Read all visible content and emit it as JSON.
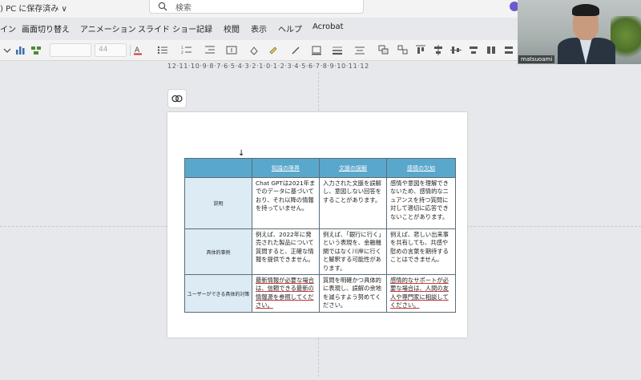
{
  "titlebar": {
    "save_status": ") PC に保存済み ∨",
    "search_placeholder": "検索"
  },
  "ribbon_tabs": [
    "イン",
    "画面切り替え",
    "アニメーション",
    "スライド ショー",
    "記録",
    "校閲",
    "表示",
    "ヘルプ",
    "Acrobat"
  ],
  "toolbar": {
    "font_name": "",
    "font_size": "44"
  },
  "ruler": {
    "text": "12·11·10·9·8·7·6·5·4·3·2·1·0·1·2·3·4·5·6·7·8·9·10·11·12"
  },
  "slide": {
    "arrow": "↓",
    "table": {
      "headers": [
        "",
        "知識の限界",
        "文脈の誤解",
        "感情の欠如"
      ],
      "rows": [
        {
          "label": "説明",
          "cells": [
            "Chat GPTは2021年までのデータに基づいており、それ以降の情報を持っていません。",
            "入力された文脈を誤解し、意図しない回答をすることがあります。",
            "感情や意図を理解できないため、感情的なニュアンスを持つ質問に対して適切に応答できないことがあります。"
          ]
        },
        {
          "label": "具体的事例",
          "cells": [
            "例えば、2022年に発売された製品について質問すると、正確な情報を提供できません。",
            "例えば、「銀行に行く」という表現を、金融機関ではなく川岸に行くと解釈する可能性があります。",
            "例えば、悲しい出来事を共有しても、共感や慰めの言葉を期待することはできません。"
          ]
        },
        {
          "label": "ユーザーができる具体的対策",
          "cells": [
            "最新情報が必要な場合は、信頼できる最新の情報源を参照してください。",
            "質問を明確かつ具体的に表現し、誤解の余地を減らすよう努めてください。",
            "感情的なサポートが必要な場合は、人間の友人や専門家に相談してください。"
          ]
        }
      ]
    }
  },
  "webcam": {
    "name": "matsuoami"
  },
  "colors": {
    "header_blue": "#5aa7cc",
    "rowhead_blue": "#dcebf4",
    "canvas_gray": "#e6e8eb"
  }
}
